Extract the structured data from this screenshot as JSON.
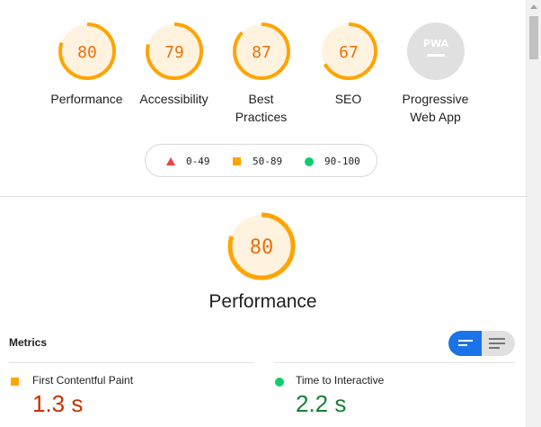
{
  "colors": {
    "average": "#ffa400",
    "average_text": "#e8710a",
    "average_bg": "#fff3e0",
    "fail": "#eb4242",
    "pass": "#0cce6b",
    "pass_text": "#188038",
    "metric_avg_text": "#c33300",
    "pwa_gray": "#e0e0e0",
    "toggle_active": "#1a73e8"
  },
  "gauges": [
    {
      "label": "Performance",
      "score": "80",
      "value": 0.8
    },
    {
      "label": "Accessibility",
      "score": "79",
      "value": 0.79
    },
    {
      "label": "Best Practices",
      "score": "87",
      "value": 0.87
    },
    {
      "label": "SEO",
      "score": "67",
      "value": 0.67
    },
    {
      "label": "Progressive Web App",
      "score": "",
      "icon": "pwa-badge-icon"
    }
  ],
  "legend": [
    {
      "symbol": "triangle-icon",
      "range": "0-49"
    },
    {
      "symbol": "square-icon",
      "range": "50-89"
    },
    {
      "symbol": "circle-icon",
      "range": "90-100"
    }
  ],
  "performance": {
    "score": "80",
    "value": 0.8,
    "title": "Performance"
  },
  "metrics": {
    "header": "Metrics",
    "items": [
      {
        "label": "First Contentful Paint",
        "value": "1.3 s",
        "rating": "average"
      },
      {
        "label": "Time to Interactive",
        "value": "2.2 s",
        "rating": "pass"
      }
    ]
  }
}
